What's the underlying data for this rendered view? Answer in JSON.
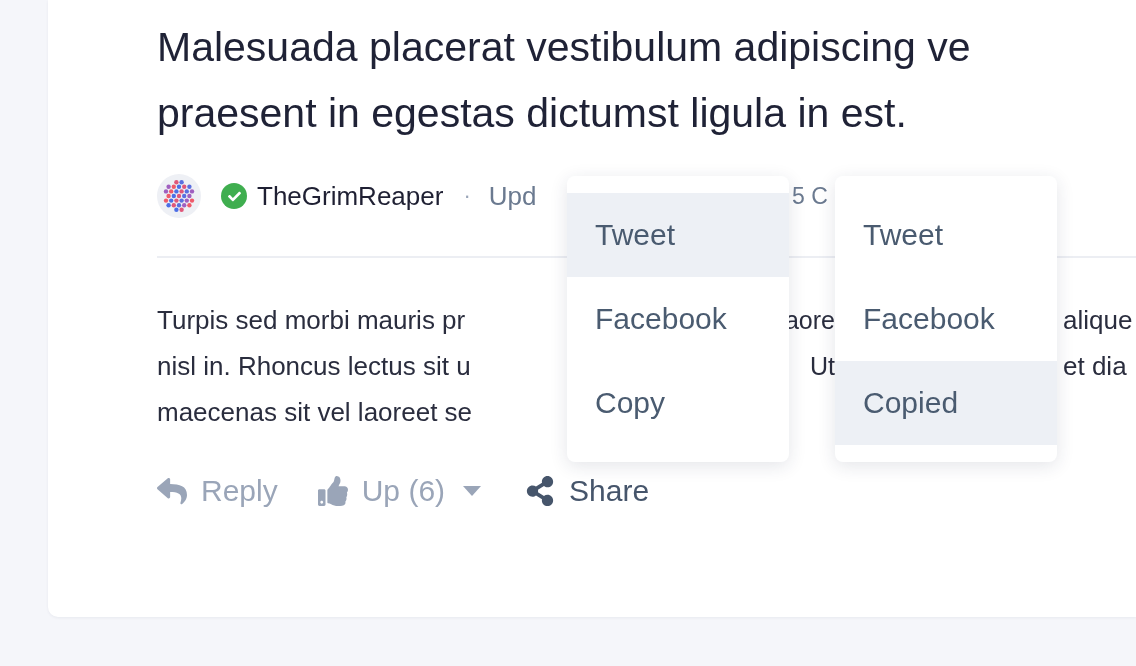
{
  "post": {
    "title_lines": [
      "Malesuada placerat vestibulum adipiscing ve",
      "praesent in egestas dictumst ligula in est."
    ],
    "author": {
      "name": "TheGrimReaper",
      "verified": true
    },
    "meta_separator": "·",
    "meta_left": "Upd",
    "meta_right": "5 C",
    "body_lines": [
      [
        "Turpis sed morbi mauris pr",
        "aore",
        "alique"
      ],
      [
        "nisl in. Rhoncus lectus sit u",
        "Ut",
        "et dia"
      ],
      [
        "maecenas sit vel laoreet se"
      ]
    ],
    "actions": [
      {
        "kind": "reply",
        "label": "Reply",
        "active": false
      },
      {
        "kind": "upvote",
        "label": "Up (6)",
        "active": false
      },
      {
        "kind": "share",
        "label": "Share",
        "active": true
      }
    ]
  },
  "share_menus": [
    {
      "items": [
        {
          "label": "Tweet",
          "selected": true
        },
        {
          "label": "Facebook",
          "selected": false
        },
        {
          "label": "Copy",
          "selected": false
        }
      ]
    },
    {
      "items": [
        {
          "label": "Tweet",
          "selected": false
        },
        {
          "label": "Facebook",
          "selected": false
        },
        {
          "label": "Copied",
          "selected": true
        }
      ]
    }
  ]
}
